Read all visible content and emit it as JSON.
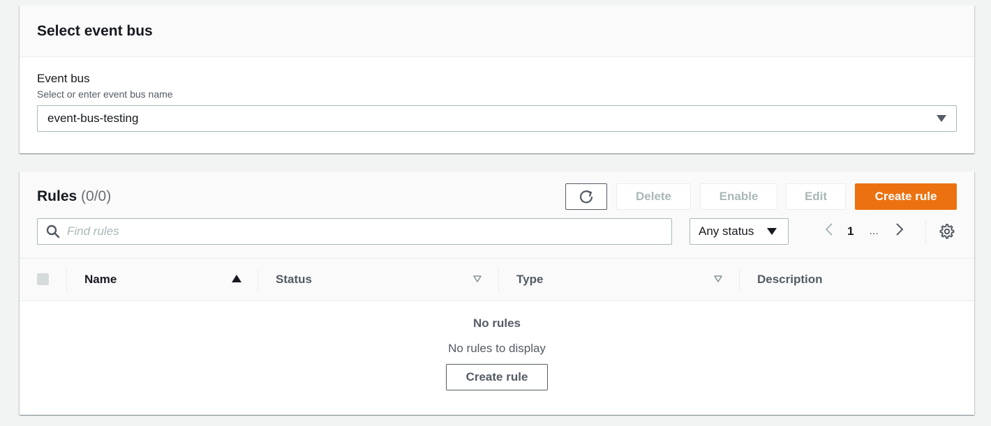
{
  "event_bus_panel": {
    "title": "Select event bus",
    "field_label": "Event bus",
    "field_description": "Select or enter event bus name",
    "selected_value": "event-bus-testing"
  },
  "rules_panel": {
    "title": "Rules",
    "count": "(0/0)",
    "buttons": {
      "refresh_icon": "refresh-icon",
      "delete": "Delete",
      "enable": "Enable",
      "edit": "Edit",
      "create_rule": "Create rule"
    },
    "search": {
      "placeholder": "Find rules",
      "value": ""
    },
    "status_filter": "Any status",
    "pagination": {
      "current_page": "1",
      "ellipsis": "..."
    },
    "table": {
      "columns": [
        {
          "label": "Name",
          "sort": "ascending"
        },
        {
          "label": "Status",
          "sort": "none"
        },
        {
          "label": "Type",
          "sort": "none"
        },
        {
          "label": "Description",
          "sort": ""
        }
      ],
      "rows": []
    },
    "empty_state": {
      "title": "No rules",
      "description": "No rules to display",
      "button": "Create rule"
    }
  },
  "colors": {
    "primary_button": "#ec7211",
    "page_background": "#f2f3f3"
  }
}
